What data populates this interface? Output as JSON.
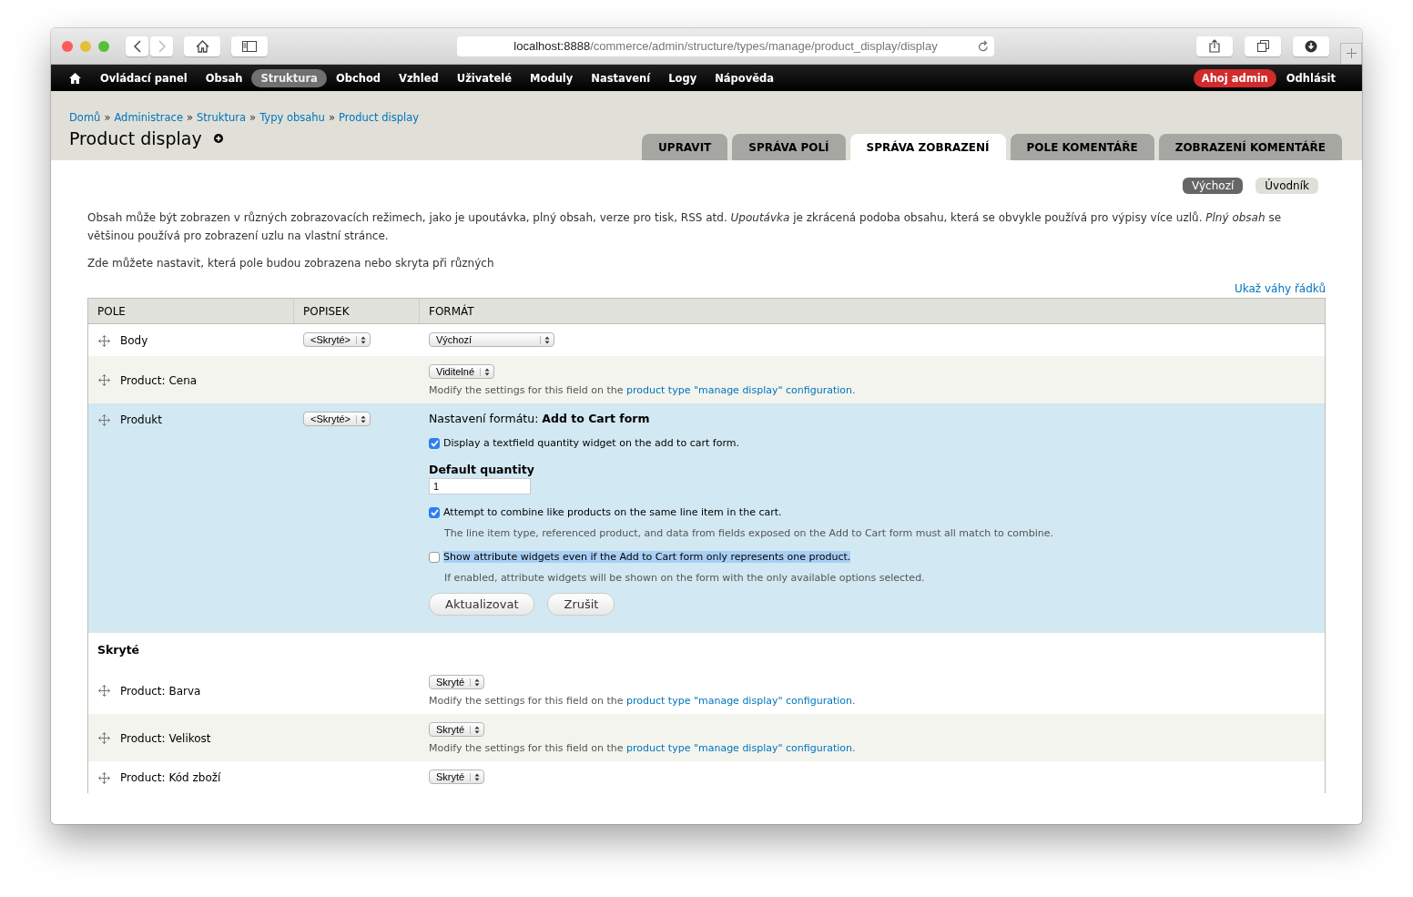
{
  "browser": {
    "url_host": "localhost:8888",
    "url_path": "/commerce/admin/structure/types/manage/product_display/display"
  },
  "toolbar": {
    "items": [
      {
        "label": "Ovládací panel",
        "selected": false
      },
      {
        "label": "Obsah",
        "selected": false
      },
      {
        "label": "Struktura",
        "selected": true
      },
      {
        "label": "Obchod",
        "selected": false
      },
      {
        "label": "Vzhled",
        "selected": false
      },
      {
        "label": "Uživatelé",
        "selected": false
      },
      {
        "label": "Moduly",
        "selected": false
      },
      {
        "label": "Nastavení",
        "selected": false
      },
      {
        "label": "Logy",
        "selected": false
      },
      {
        "label": "Nápověda",
        "selected": false
      }
    ],
    "greeting": "Ahoj admin",
    "logout": "Odhlásit"
  },
  "breadcrumb": [
    "Domů",
    "Administrace",
    "Struktura",
    "Typy obsahu",
    "Product display"
  ],
  "breadcrumb_separator": "»",
  "title": "Product display",
  "tabs": [
    {
      "label": "UPRAVIT",
      "selected": false
    },
    {
      "label": "SPRÁVA POLÍ",
      "selected": false
    },
    {
      "label": "SPRÁVA ZOBRAZENÍ",
      "selected": true
    },
    {
      "label": "POLE KOMENTÁŘE",
      "selected": false
    },
    {
      "label": "ZOBRAZENÍ KOMENTÁŘE",
      "selected": false
    }
  ],
  "view_modes": [
    {
      "label": "Výchozí",
      "selected": true
    },
    {
      "label": "Úvodník",
      "selected": false
    }
  ],
  "description": [
    "Obsah může být zobrazen v různých zobrazovacích režimech, jako je upoutávka, plný obsah, verze pro tisk, RSS atd. *Upoutávka* je zkrácená podoba obsahu, která se obvykle používá pro výpisy více uzlů. *Plný obsah* se většinou používá pro zobrazení uzlu na vlastní stránce.",
    "Zde můžete nastavit, která pole budou zobrazena nebo skryta při různých"
  ],
  "weights_link": "Ukaž váhy řádků",
  "table": {
    "columns": [
      "POLE",
      "POPISEK",
      "FORMÁT"
    ],
    "rows": [
      {
        "kind": "field",
        "label": "Body",
        "popisek": "<Skryté>",
        "format": "Výchozí",
        "selected": false
      },
      {
        "kind": "field",
        "label": "Product: Cena",
        "format": "Viditelné",
        "note": "Modify the settings for this field on the ",
        "note_link": "product type \"manage display\" configuration",
        "note_end": ".",
        "selected": false
      },
      {
        "kind": "field",
        "label": "Produkt",
        "popisek": "<Skryté>",
        "selected": true,
        "settings": {
          "heading": "Nastavení formátu: **Add to Cart form**",
          "items": [
            {
              "kind": "checkbox",
              "label": "Display a textfield quantity widget on the add to cart form.",
              "checked": true,
              "highlighted": false
            },
            {
              "kind": "textfield",
              "label": "Default quantity",
              "value": "1"
            },
            {
              "kind": "checkbox",
              "label": "Attempt to combine like products on the same line item in the cart.",
              "checked": true,
              "highlighted": false,
              "help": "The line item type, referenced product, and data from fields exposed on the Add to Cart form must all match to combine."
            },
            {
              "kind": "checkbox",
              "label": "Show attribute widgets even if the Add to Cart form only represents one product.",
              "checked": false,
              "highlighted": true,
              "help": "If enabled, attribute widgets will be shown on the form with the only available options selected."
            }
          ],
          "buttons": [
            "Aktualizovat",
            "Zrušit"
          ]
        }
      },
      {
        "kind": "region",
        "label": "Skryté"
      },
      {
        "kind": "field",
        "label": "Product: Barva",
        "format": "Skryté",
        "note": "Modify the settings for this field on the ",
        "note_link": "product type \"manage display\" configuration",
        "note_end": ".",
        "selected": false
      },
      {
        "kind": "field",
        "label": "Product: Velikost",
        "format": "Skryté",
        "note": "Modify the settings for this field on the ",
        "note_link": "product type \"manage display\" configuration",
        "note_end": ".",
        "selected": false
      },
      {
        "kind": "field",
        "label": "Product: Kód zboží",
        "format": "Skryté",
        "selected": false
      }
    ]
  }
}
